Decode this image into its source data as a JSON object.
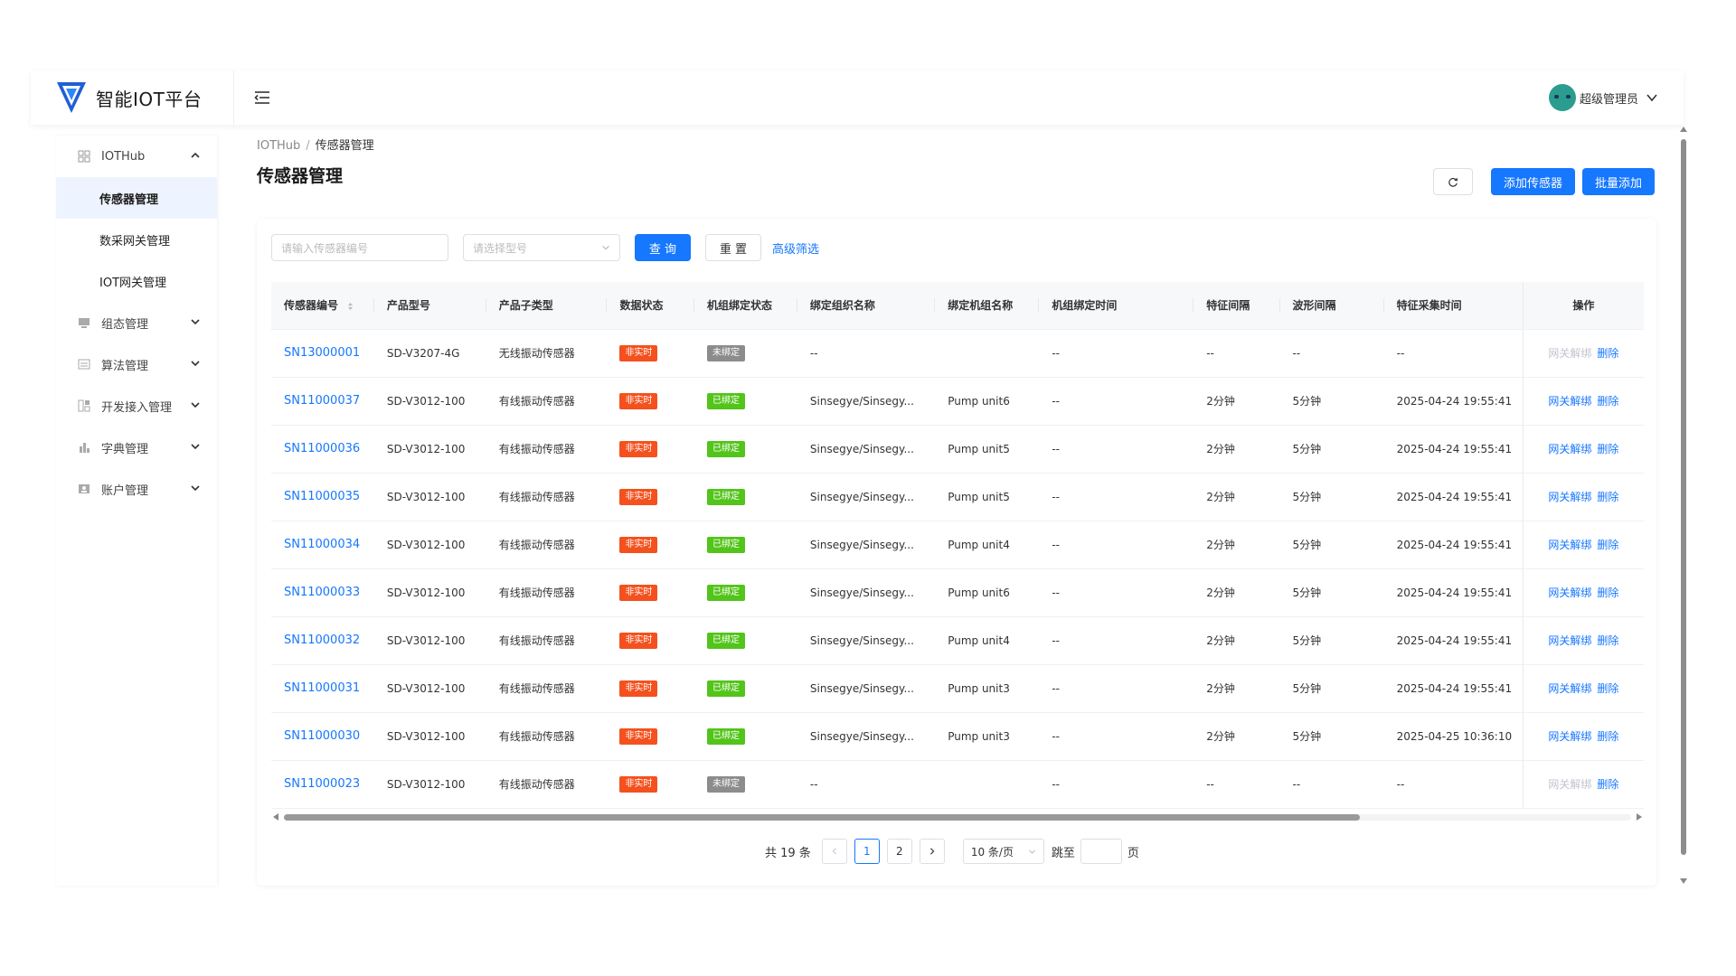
{
  "app": {
    "title": "智能IOT平台",
    "brand_color": "#1677ff"
  },
  "user": {
    "name": "超级管理员"
  },
  "sidebar": {
    "groups": [
      {
        "label": "IOTHub",
        "icon": "grid-icon",
        "expanded": true
      },
      {
        "label": "组态管理",
        "icon": "monitor-icon"
      },
      {
        "label": "算法管理",
        "icon": "list-icon"
      },
      {
        "label": "开发接入管理",
        "icon": "code-icon"
      },
      {
        "label": "字典管理",
        "icon": "chart-icon"
      },
      {
        "label": "账户管理",
        "icon": "user-card-icon"
      }
    ],
    "sub_items": [
      {
        "label": "传感器管理",
        "active": true
      },
      {
        "label": "数采网关管理"
      },
      {
        "label": "IOT网关管理"
      }
    ]
  },
  "breadcrumb": {
    "root": "IOTHub",
    "current": "传感器管理"
  },
  "page_title": "传感器管理",
  "toolbar": {
    "add_label": "添加传感器",
    "batch_label": "批量添加"
  },
  "filters": {
    "sn_placeholder": "请输入传感器编号",
    "model_placeholder": "请选择型号",
    "query_label": "查 询",
    "reset_label": "重 置",
    "advanced_label": "高级筛选"
  },
  "table": {
    "headers": [
      "传感器编号",
      "产品型号",
      "产品子类型",
      "数据状态",
      "机组绑定状态",
      "绑定组织名称",
      "绑定机组名称",
      "机组绑定时间",
      "特征间隔",
      "波形间隔",
      "特征采集时间",
      "操作"
    ],
    "op_unbind": "网关解绑",
    "op_delete": "删除",
    "rows": [
      {
        "sn": "SN13000001",
        "model": "SD-V3207-4G",
        "subtype": "无线振动传感器",
        "data_status": "非实时",
        "bind_status": "未绑定",
        "bound": false,
        "org": "--",
        "unit": "",
        "bind_time": "--",
        "feat_interval": "--",
        "wave_interval": "--",
        "collect_time": "--"
      },
      {
        "sn": "SN11000037",
        "model": "SD-V3012-100",
        "subtype": "有线振动传感器",
        "data_status": "非实时",
        "bind_status": "已绑定",
        "bound": true,
        "org": "Sinsegye/Sinsegy...",
        "unit": "Pump unit6",
        "bind_time": "--",
        "feat_interval": "2分钟",
        "wave_interval": "5分钟",
        "collect_time": "2025-04-24 19:55:41"
      },
      {
        "sn": "SN11000036",
        "model": "SD-V3012-100",
        "subtype": "有线振动传感器",
        "data_status": "非实时",
        "bind_status": "已绑定",
        "bound": true,
        "org": "Sinsegye/Sinsegy...",
        "unit": "Pump unit5",
        "bind_time": "--",
        "feat_interval": "2分钟",
        "wave_interval": "5分钟",
        "collect_time": "2025-04-24 19:55:41"
      },
      {
        "sn": "SN11000035",
        "model": "SD-V3012-100",
        "subtype": "有线振动传感器",
        "data_status": "非实时",
        "bind_status": "已绑定",
        "bound": true,
        "org": "Sinsegye/Sinsegy...",
        "unit": "Pump unit5",
        "bind_time": "--",
        "feat_interval": "2分钟",
        "wave_interval": "5分钟",
        "collect_time": "2025-04-24 19:55:41"
      },
      {
        "sn": "SN11000034",
        "model": "SD-V3012-100",
        "subtype": "有线振动传感器",
        "data_status": "非实时",
        "bind_status": "已绑定",
        "bound": true,
        "org": "Sinsegye/Sinsegy...",
        "unit": "Pump unit4",
        "bind_time": "--",
        "feat_interval": "2分钟",
        "wave_interval": "5分钟",
        "collect_time": "2025-04-24 19:55:41"
      },
      {
        "sn": "SN11000033",
        "model": "SD-V3012-100",
        "subtype": "有线振动传感器",
        "data_status": "非实时",
        "bind_status": "已绑定",
        "bound": true,
        "org": "Sinsegye/Sinsegy...",
        "unit": "Pump unit6",
        "bind_time": "--",
        "feat_interval": "2分钟",
        "wave_interval": "5分钟",
        "collect_time": "2025-04-24 19:55:41"
      },
      {
        "sn": "SN11000032",
        "model": "SD-V3012-100",
        "subtype": "有线振动传感器",
        "data_status": "非实时",
        "bind_status": "已绑定",
        "bound": true,
        "org": "Sinsegye/Sinsegy...",
        "unit": "Pump unit4",
        "bind_time": "--",
        "feat_interval": "2分钟",
        "wave_interval": "5分钟",
        "collect_time": "2025-04-24 19:55:41"
      },
      {
        "sn": "SN11000031",
        "model": "SD-V3012-100",
        "subtype": "有线振动传感器",
        "data_status": "非实时",
        "bind_status": "已绑定",
        "bound": true,
        "org": "Sinsegye/Sinsegy...",
        "unit": "Pump unit3",
        "bind_time": "--",
        "feat_interval": "2分钟",
        "wave_interval": "5分钟",
        "collect_time": "2025-04-24 19:55:41"
      },
      {
        "sn": "SN11000030",
        "model": "SD-V3012-100",
        "subtype": "有线振动传感器",
        "data_status": "非实时",
        "bind_status": "已绑定",
        "bound": true,
        "org": "Sinsegye/Sinsegy...",
        "unit": "Pump unit3",
        "bind_time": "--",
        "feat_interval": "2分钟",
        "wave_interval": "5分钟",
        "collect_time": "2025-04-25 10:36:10"
      },
      {
        "sn": "SN11000023",
        "model": "SD-V3012-100",
        "subtype": "有线振动传感器",
        "data_status": "非实时",
        "bind_status": "未绑定",
        "bound": false,
        "org": "--",
        "unit": "",
        "bind_time": "--",
        "feat_interval": "--",
        "wave_interval": "--",
        "collect_time": "--"
      }
    ]
  },
  "pagination": {
    "total_label": "共 19 条",
    "pages": [
      "1",
      "2"
    ],
    "current_page": "1",
    "page_size_label": "10 条/页",
    "jump_label": "跳至",
    "page_suffix": "页"
  },
  "colors": {
    "realtime_off": "#f4511e",
    "bound": "#52c41a",
    "unbound": "#8c8c8c"
  }
}
